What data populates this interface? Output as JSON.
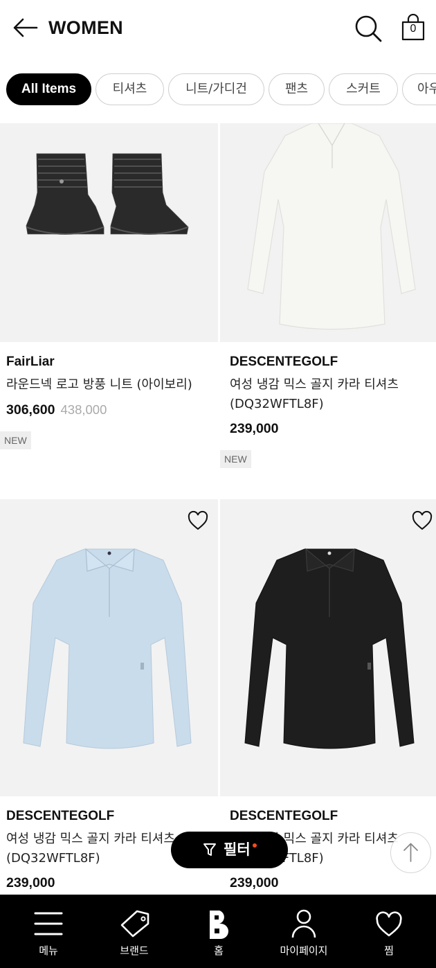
{
  "header": {
    "title": "WOMEN",
    "cart_count": "0"
  },
  "chips": [
    "All Items",
    "티셔츠",
    "니트/가디건",
    "팬츠",
    "스커트",
    "아우"
  ],
  "products": [
    {
      "brand": "FairLiar",
      "name": "라운드넥 로고 방풍 니트 (아이보리)",
      "price": "306,600",
      "original_price": "438,000",
      "badge": "NEW"
    },
    {
      "brand": "DESCENTEGOLF",
      "name": "여성 냉감 믹스 골지 카라 티셔츠 (DQ32WFTL8F)",
      "price": "239,000",
      "badge": "NEW"
    },
    {
      "brand": "DESCENTEGOLF",
      "name": "여성 냉감 믹스 골지 카라 티셔츠 (DQ32WFTL8F)",
      "price": "239,000"
    },
    {
      "brand": "DESCENTEGOLF",
      "name": "여성 냉감 믹스 골지 카라 티셔츠 (DQ32WFTL8F)",
      "price": "239,000"
    }
  ],
  "filter": {
    "label": "필터"
  },
  "bottom_nav": [
    {
      "label": "메뉴",
      "icon": "menu-icon"
    },
    {
      "label": "브랜드",
      "icon": "tag-icon"
    },
    {
      "label": "홈",
      "icon": "brand-b-logo"
    },
    {
      "label": "마이페이지",
      "icon": "person-icon"
    },
    {
      "label": "찜",
      "icon": "heart-icon"
    }
  ],
  "colors": {
    "accent": "#ff4a1c",
    "nav_bg": "#000000",
    "chip_active": "#000000",
    "shirt_light_blue": "#c9dcec",
    "shirt_black": "#1e1e1e",
    "shirt_white": "#f6f6f3"
  }
}
